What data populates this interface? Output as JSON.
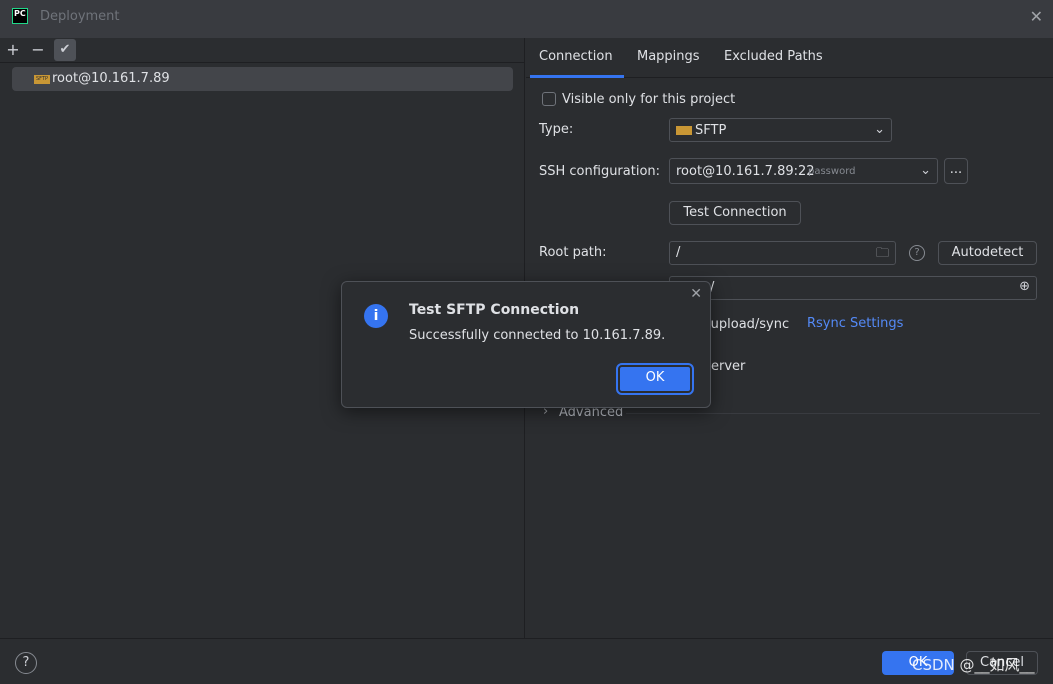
{
  "window": {
    "title": "Deployment",
    "logo": "PC"
  },
  "toolbar": {
    "add": "+",
    "remove": "−",
    "apply": "✔"
  },
  "servers": [
    {
      "name": "root@10.161.7.89",
      "icon": "sftp-icon",
      "icon_text": "SFTP"
    }
  ],
  "tabs": [
    {
      "label": "Connection",
      "active": true
    },
    {
      "label": "Mappings"
    },
    {
      "label": "Excluded Paths"
    }
  ],
  "form": {
    "visible_only": {
      "label": "Visible only for this project",
      "checked": false
    },
    "type": {
      "label": "Type:",
      "value": "SFTP"
    },
    "ssh": {
      "label": "SSH configuration:",
      "value": "root@10.161.7.89:22",
      "hint": "password",
      "more": "..."
    },
    "test_connection": "Test Connection",
    "root_path": {
      "label": "Root path:",
      "value": "/",
      "autodetect": "Autodetect"
    },
    "web_url_partial": "/",
    "sync_partial": "d/upload/sync",
    "rsync_settings": "Rsync Settings",
    "server_partial": "erver",
    "advanced": "Advanced"
  },
  "dialog": {
    "title": "Test SFTP Connection",
    "message": "Successfully connected to 10.161.7.89.",
    "ok": "OK"
  },
  "footer": {
    "help": "?",
    "ok": "OK",
    "cancel": "Cancel"
  },
  "watermark": "CSDN @__如风__",
  "colors": {
    "accent": "#3574f0",
    "link": "#548af7",
    "background": "#2b2d30"
  }
}
